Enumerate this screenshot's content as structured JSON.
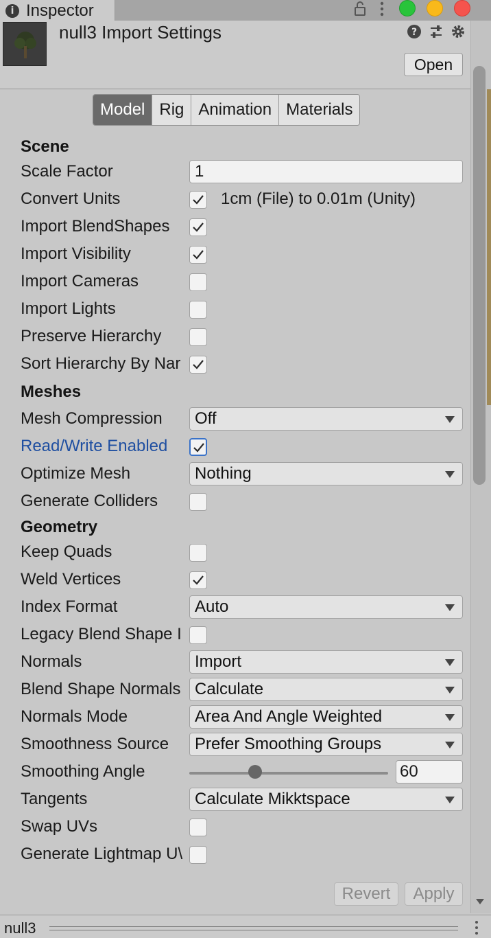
{
  "window": {
    "tab_title": "Inspector",
    "tab_icon": "info-icon",
    "colors": {
      "close": "#f5544d",
      "minimize": "#f9b91b",
      "zoom": "#29c43b"
    }
  },
  "header": {
    "title": "null3 Import Settings",
    "open_label": "Open",
    "icons": [
      "help-icon",
      "sliders-icon",
      "gear-icon"
    ]
  },
  "tabs": [
    {
      "label": "Model",
      "active": true
    },
    {
      "label": "Rig",
      "active": false
    },
    {
      "label": "Animation",
      "active": false
    },
    {
      "label": "Materials",
      "active": false
    }
  ],
  "scene": {
    "heading": "Scene",
    "scale_factor_label": "Scale Factor",
    "scale_factor_value": "1",
    "convert_units_label": "Convert Units",
    "convert_units_checked": true,
    "convert_units_note": "1cm (File) to 0.01m (Unity)",
    "import_blendshapes_label": "Import BlendShapes",
    "import_blendshapes_checked": true,
    "import_visibility_label": "Import Visibility",
    "import_visibility_checked": true,
    "import_cameras_label": "Import Cameras",
    "import_cameras_checked": false,
    "import_lights_label": "Import Lights",
    "import_lights_checked": false,
    "preserve_hierarchy_label": "Preserve Hierarchy",
    "preserve_hierarchy_checked": false,
    "sort_hierarchy_label": "Sort Hierarchy By Nar",
    "sort_hierarchy_checked": true
  },
  "meshes": {
    "heading": "Meshes",
    "mesh_compression_label": "Mesh Compression",
    "mesh_compression_value": "Off",
    "read_write_label": "Read/Write Enabled",
    "read_write_checked": true,
    "optimize_mesh_label": "Optimize Mesh",
    "optimize_mesh_value": "Nothing",
    "generate_colliders_label": "Generate Colliders",
    "generate_colliders_checked": false
  },
  "geometry": {
    "heading": "Geometry",
    "keep_quads_label": "Keep Quads",
    "keep_quads_checked": false,
    "weld_vertices_label": "Weld Vertices",
    "weld_vertices_checked": true,
    "index_format_label": "Index Format",
    "index_format_value": "Auto",
    "legacy_blend_label": "Legacy Blend Shape I",
    "legacy_blend_checked": false,
    "normals_label": "Normals",
    "normals_value": "Import",
    "blend_shape_normals_label": "Blend Shape Normals",
    "blend_shape_normals_value": "Calculate",
    "normals_mode_label": "Normals Mode",
    "normals_mode_value": "Area And Angle Weighted",
    "smoothness_source_label": "Smoothness Source",
    "smoothness_source_value": "Prefer Smoothing Groups",
    "smoothing_angle_label": "Smoothing Angle",
    "smoothing_angle_value": "60",
    "smoothing_angle_fraction": 0.33,
    "tangents_label": "Tangents",
    "tangents_value": "Calculate Mikktspace",
    "swap_uvs_label": "Swap UVs",
    "swap_uvs_checked": false,
    "lightmap_uvs_label": "Generate Lightmap U\\",
    "lightmap_uvs_checked": false
  },
  "footer": {
    "revert_label": "Revert",
    "apply_label": "Apply"
  },
  "bottom": {
    "title": "null3"
  }
}
